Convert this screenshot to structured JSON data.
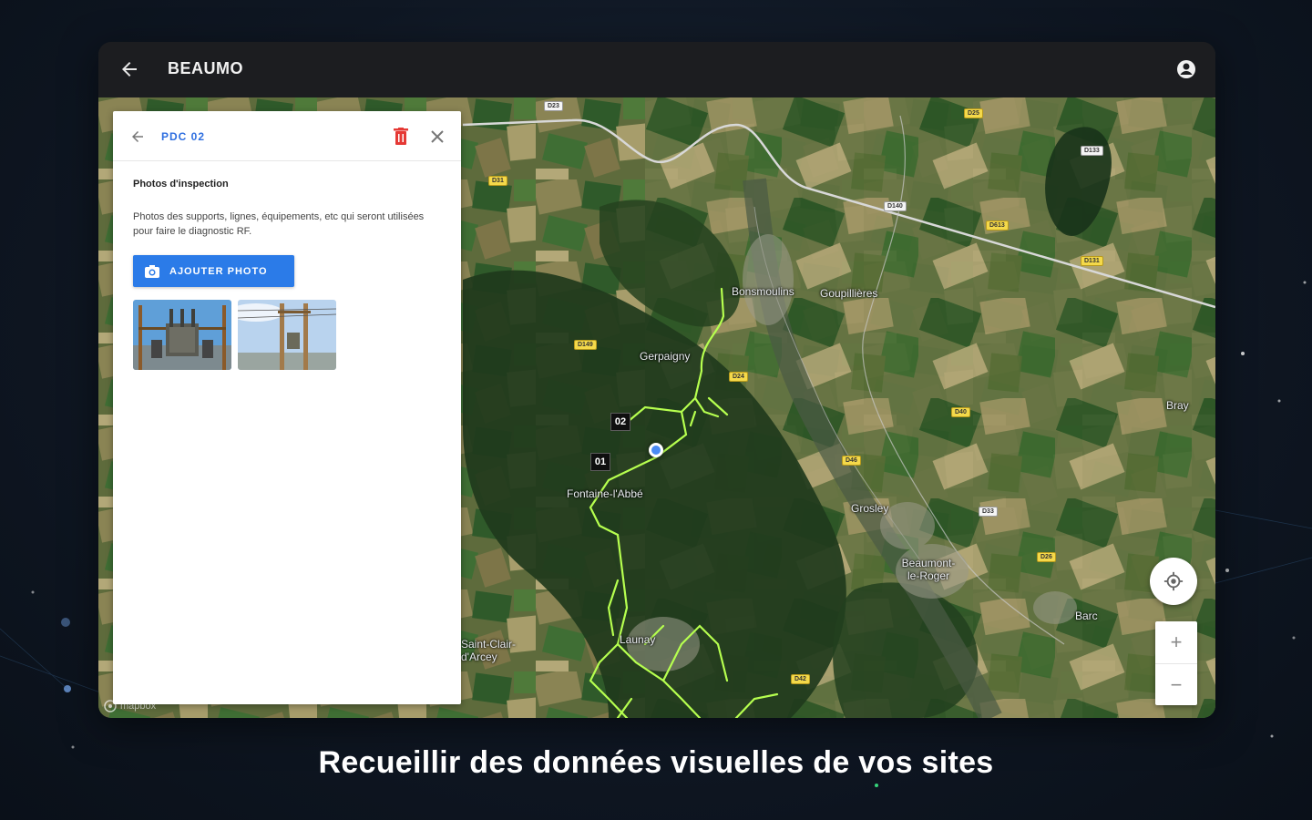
{
  "app": {
    "title": "BEAUMO"
  },
  "panel": {
    "title": "PDC 02",
    "section_title": "Photos d'inspection",
    "section_description": "Photos des supports, lignes, équipements, etc qui seront utilisées pour faire le diagnostic RF.",
    "add_photo_label": "AJOUTER PHOTO",
    "photos": [
      {
        "subject": "transformer-photo"
      },
      {
        "subject": "pole-transformer-photo"
      }
    ]
  },
  "map": {
    "places": [
      {
        "name": "Gerpaigny"
      },
      {
        "name": "Fontaine-l'Abbé"
      },
      {
        "name": "Beaumont-le-Roger"
      },
      {
        "name": "Barc"
      },
      {
        "name": "Bray"
      },
      {
        "name": "Saint-Clair-d'Arcey"
      },
      {
        "name": "Launay"
      },
      {
        "name": "Bonsmoulins"
      },
      {
        "name": "Goupillières"
      },
      {
        "name": "Grosley"
      }
    ],
    "markers": [
      {
        "label": "01"
      },
      {
        "label": "02"
      }
    ],
    "road_labels": [
      "D23",
      "D31",
      "D25",
      "D133",
      "D140",
      "D613",
      "D131",
      "D24",
      "D149",
      "D40",
      "D46",
      "D33",
      "D26",
      "D42"
    ],
    "attribution": "mapbox",
    "zoom_in": "+",
    "zoom_out": "−"
  },
  "caption": "Recueillir des données visuelles de vos sites",
  "colors": {
    "accent": "#2b7be8",
    "delete": "#e53935",
    "power_line": "#b6ff4f"
  }
}
